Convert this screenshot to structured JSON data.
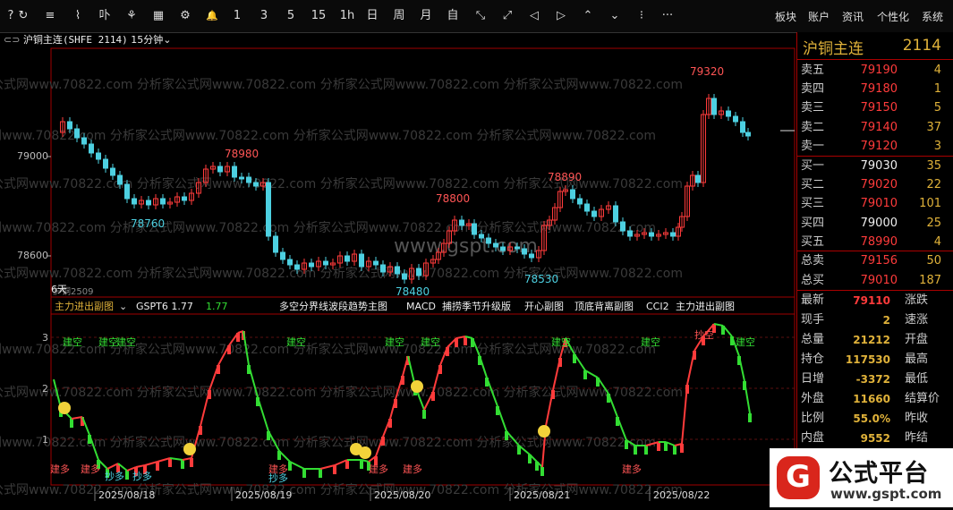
{
  "toolbar": {
    "icons": [
      "?",
      "↻",
      "≡",
      "⌇",
      "卟",
      "⚘",
      "▦",
      "⚙",
      "🔔"
    ],
    "periods": [
      "1",
      "3",
      "5",
      "15",
      "1h",
      "日",
      "周",
      "月"
    ],
    "icons2": [
      "自",
      "⤡",
      "⤢",
      "◁",
      "▷",
      "⌃",
      "⌄",
      "⁝",
      "···"
    ],
    "menu": [
      "板块",
      "账户",
      "资讯",
      "个性化",
      "系统"
    ]
  },
  "title": {
    "symbol": "沪铜主连",
    "code_period": "(SHFE 2114)",
    "period": "15分钟"
  },
  "watermark": "公式网www.70822.com 分析家公式网www.70822.com 分析家公式网www.70822.com 分析家公式网www.70822.com",
  "center_watermark": "www.gspt.com",
  "main_chart": {
    "y_labels": [
      "79000",
      "78600"
    ],
    "price_labels": [
      "79320",
      "78980",
      "78760",
      "78800",
      "78890",
      "78480",
      "78530"
    ],
    "bottom_label": "沪铜2509",
    "bottom_label2": "6天"
  },
  "indicator_bar": {
    "name": "主力进出副图",
    "gspt": "GSPT6 1.77",
    "value": "1.77",
    "tabs": [
      "多空分界线波段趋势主图",
      "MACD",
      "捕捞季节升级版",
      "开心副图",
      "顶底背离副图",
      "CCI2",
      "主力进出副图"
    ]
  },
  "sub_chart": {
    "y_labels": [
      "3",
      "2",
      "1"
    ],
    "labels_jiankong": [
      "建空",
      "建空",
      "建空",
      "建空",
      "建空",
      "建空",
      "建空",
      "建空",
      "建空"
    ],
    "label_chaokong": "抄空",
    "labels_jianduo": [
      "建多",
      "建多",
      "建多",
      "建多",
      "建多"
    ],
    "labels_chaoduo": [
      "抄多",
      "抄多",
      "抄多"
    ]
  },
  "dates": [
    "2025/08/18",
    "2025/08/19",
    "2025/08/20",
    "2025/08/21",
    "2025/08/22"
  ],
  "side": {
    "symbol": "沪铜主连",
    "code": "2114",
    "asks": [
      {
        "label": "卖五",
        "price": "79190",
        "vol": "4"
      },
      {
        "label": "卖四",
        "price": "79180",
        "vol": "1"
      },
      {
        "label": "卖三",
        "price": "79150",
        "vol": "5"
      },
      {
        "label": "卖二",
        "price": "79140",
        "vol": "37"
      },
      {
        "label": "卖一",
        "price": "79120",
        "vol": "3"
      }
    ],
    "bids": [
      {
        "label": "买一",
        "price": "79030",
        "vol": "35"
      },
      {
        "label": "买二",
        "price": "79020",
        "vol": "22"
      },
      {
        "label": "买三",
        "price": "79010",
        "vol": "101"
      },
      {
        "label": "买四",
        "price": "79000",
        "vol": "25"
      },
      {
        "label": "买五",
        "price": "78990",
        "vol": "4"
      }
    ],
    "totals": [
      {
        "label": "总卖",
        "price": "79156",
        "vol": "50"
      },
      {
        "label": "总买",
        "price": "79010",
        "vol": "187"
      }
    ],
    "quotes": [
      {
        "l1": "最新",
        "v1": "79110",
        "c": "#ff3b3b",
        "l2": "涨跌"
      },
      {
        "l1": "现手",
        "v1": "2",
        "c": "#e0b23a",
        "l2": "速涨"
      },
      {
        "l1": "总量",
        "v1": "21212",
        "c": "#e0b23a",
        "l2": "开盘"
      },
      {
        "l1": "持仓",
        "v1": "117530",
        "c": "#e0b23a",
        "l2": "最高"
      },
      {
        "l1": "日增",
        "v1": "-3372",
        "c": "#e0b23a",
        "l2": "最低"
      },
      {
        "l1": "外盘",
        "v1": "11660",
        "c": "#e0b23a",
        "l2": "结算价"
      },
      {
        "l1": "比例",
        "v1": "55.0%",
        "c": "#e0b23a",
        "l2": "昨收"
      },
      {
        "l1": "内盘",
        "v1": "9552",
        "c": "#e0b23a",
        "l2": "昨结"
      }
    ]
  },
  "logo": {
    "name": "公式平台",
    "url": "www.gspt.com",
    "mark": "G"
  },
  "colors": {
    "up": "#ff3b3b",
    "down": "#4dd0e1",
    "green": "#33dd33",
    "gold": "#e0b23a",
    "border": "#a00000"
  }
}
